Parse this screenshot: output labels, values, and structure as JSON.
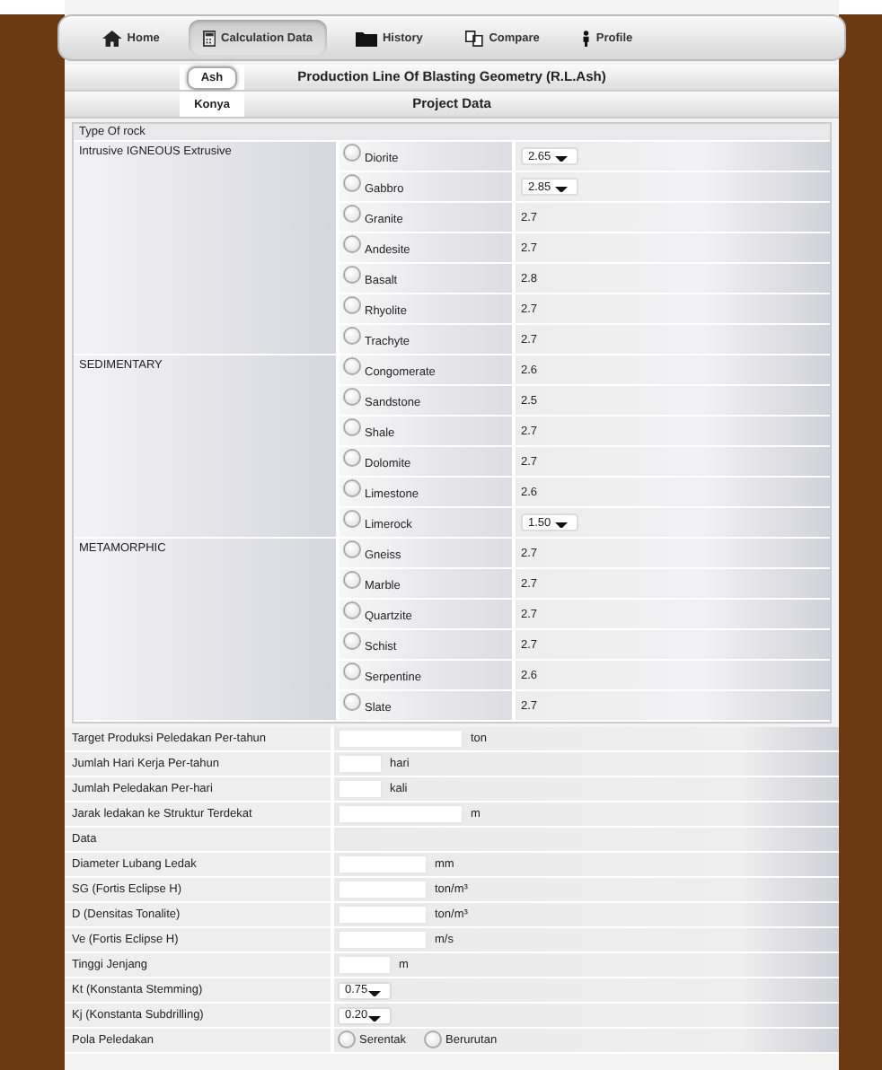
{
  "nav": [
    {
      "label": "Home",
      "selected": false
    },
    {
      "label": "Calculation Data",
      "selected": true
    },
    {
      "label": "History",
      "selected": false
    },
    {
      "label": "Compare",
      "selected": false
    },
    {
      "label": "Profile",
      "selected": false
    }
  ],
  "sub_tabs": [
    {
      "label": "Ash",
      "selected": true
    },
    {
      "label": "Konya",
      "selected": false
    }
  ],
  "titles": [
    "Production Line Of Blasting Geometry (R.L.Ash)",
    "Project Data"
  ],
  "rock_table": {
    "header": "Type Of rock",
    "groups": [
      {
        "name": "Intrusive IGNEOUS Extrusive",
        "rocks": [
          {
            "name": "Diorite",
            "selected": false,
            "kind": "select",
            "value": "2.65"
          },
          {
            "name": "Gabbro",
            "selected": false,
            "kind": "select",
            "value": "2.85"
          },
          {
            "name": "Granite",
            "selected": false,
            "kind": "text",
            "value": "2.7"
          },
          {
            "name": "Andesite",
            "selected": false,
            "kind": "text",
            "value": "2.7"
          },
          {
            "name": "Basalt",
            "selected": false,
            "kind": "text",
            "value": "2.8"
          },
          {
            "name": "Rhyolite",
            "selected": false,
            "kind": "text",
            "value": "2.7"
          },
          {
            "name": "Trachyte",
            "selected": false,
            "kind": "text",
            "value": "2.7"
          }
        ]
      },
      {
        "name": "SEDIMENTARY",
        "rocks": [
          {
            "name": "Congomerate",
            "selected": false,
            "kind": "text",
            "value": "2.6"
          },
          {
            "name": "Sandstone",
            "selected": false,
            "kind": "text",
            "value": "2.5"
          },
          {
            "name": "Shale",
            "selected": false,
            "kind": "text",
            "value": "2.7"
          },
          {
            "name": "Dolomite",
            "selected": false,
            "kind": "text",
            "value": "2.7"
          },
          {
            "name": "Limestone",
            "selected": false,
            "kind": "text",
            "value": "2.6"
          },
          {
            "name": "Limerock",
            "selected": false,
            "kind": "select",
            "value": "1.50"
          }
        ]
      },
      {
        "name": "METAMORPHIC",
        "rocks": [
          {
            "name": "Gneiss",
            "selected": false,
            "kind": "text",
            "value": "2.7"
          },
          {
            "name": "Marble",
            "selected": false,
            "kind": "text",
            "value": "2.7"
          },
          {
            "name": "Quartzite",
            "selected": false,
            "kind": "text",
            "value": "2.7"
          },
          {
            "name": "Schist",
            "selected": false,
            "kind": "text",
            "value": "2.7"
          },
          {
            "name": "Serpentine",
            "selected": false,
            "kind": "text",
            "value": "2.6"
          },
          {
            "name": "Slate",
            "selected": false,
            "kind": "text",
            "value": "2.7"
          }
        ]
      }
    ]
  },
  "form": [
    {
      "kind": "input",
      "label": "Target Produksi Peledakan Per-tahun",
      "unit": "ton"
    },
    {
      "kind": "input",
      "label": "Jumlah Hari Kerja Per-tahun",
      "unit": "hari"
    },
    {
      "kind": "input",
      "label": "Jumlah Peledakan Per-hari",
      "unit": "kali"
    },
    {
      "kind": "input",
      "label": "Jarak ledakan ke Struktur Terdekat",
      "unit": "m"
    },
    {
      "kind": "section",
      "label": "Data"
    },
    {
      "kind": "input",
      "label": "Diameter Lubang Ledak",
      "unit": "mm"
    },
    {
      "kind": "input",
      "label": "SG (Fortis Eclipse H)",
      "unit": "ton/m³"
    },
    {
      "kind": "input",
      "label": "D (Densitas Tonalite)",
      "unit": "ton/m³"
    },
    {
      "kind": "input",
      "label": "Ve (Fortis Eclipse H)",
      "unit": "m/s"
    },
    {
      "kind": "input",
      "label": "Tinggi Jenjang",
      "unit": "m"
    },
    {
      "kind": "select",
      "label": "Kt (Konstanta Stemming)",
      "value": "0.75"
    },
    {
      "kind": "select",
      "label": "Kj (Konstanta Subdrilling)",
      "value": "0.20"
    },
    {
      "kind": "radio",
      "label": "Pola Peledakan",
      "options": [
        {
          "label": "Serentak",
          "selected": false
        },
        {
          "label": "Berurutan",
          "selected": false
        }
      ]
    }
  ]
}
